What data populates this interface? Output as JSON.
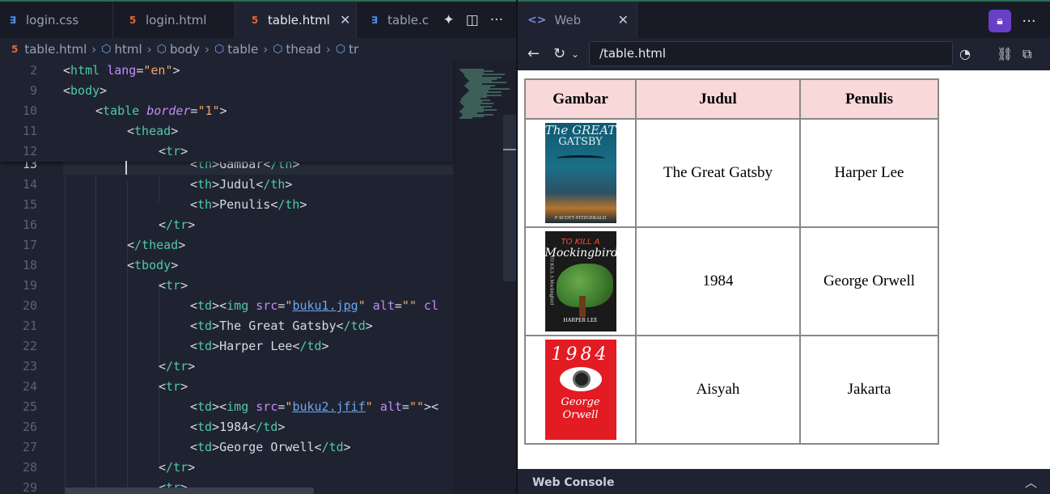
{
  "editor": {
    "tabs": [
      {
        "label": "login.css",
        "icon": "css-file-icon",
        "active": false
      },
      {
        "label": "login.html",
        "icon": "html-file-icon",
        "active": false
      },
      {
        "label": "table.html",
        "icon": "html-file-icon",
        "active": true
      },
      {
        "label": "table.c",
        "icon": "css-file-icon",
        "active": false
      }
    ],
    "breadcrumb": [
      "table.html",
      "html",
      "body",
      "table",
      "thead",
      "tr"
    ],
    "line_numbers": [
      "2",
      "9",
      "10",
      "11",
      "12",
      "13",
      "14",
      "15",
      "16",
      "17",
      "18",
      "19",
      "20",
      "21",
      "22",
      "23",
      "24",
      "25",
      "26",
      "27",
      "28",
      "29"
    ],
    "sticky_lines": [
      {
        "num": "2",
        "code": "<html lang=\"en\">"
      },
      {
        "num": "9",
        "code": "<body>"
      },
      {
        "num": "10",
        "code": "<table border=\"1\">"
      },
      {
        "num": "11",
        "code": "<thead>"
      },
      {
        "num": "12",
        "code": "<tr>"
      }
    ],
    "lines": [
      {
        "num": "13",
        "code": "<th>Gambar</th>"
      },
      {
        "num": "14",
        "code": "<th>Judul</th>"
      },
      {
        "num": "15",
        "code": "<th>Penulis</th>"
      },
      {
        "num": "16",
        "code": "</tr>"
      },
      {
        "num": "17",
        "code": "</thead>"
      },
      {
        "num": "18",
        "code": "<tbody>"
      },
      {
        "num": "19",
        "code": "<tr>"
      },
      {
        "num": "20",
        "code": "<td><img src=\"buku1.jpg\" alt=\"\" cl"
      },
      {
        "num": "21",
        "code": "<td>The Great Gatsby</td>"
      },
      {
        "num": "22",
        "code": "<td>Harper Lee</td>"
      },
      {
        "num": "23",
        "code": "</tr>"
      },
      {
        "num": "24",
        "code": "<tr>"
      },
      {
        "num": "25",
        "code": "<td><img src=\"buku2.jfif\" alt=\"\"><"
      },
      {
        "num": "26",
        "code": "<td>1984</td>"
      },
      {
        "num": "27",
        "code": "<td>George Orwell</td>"
      },
      {
        "num": "28",
        "code": "</tr>"
      },
      {
        "num": "29",
        "code": "<tr>"
      }
    ]
  },
  "browser": {
    "tab_label": "Web",
    "url": "/table.html",
    "table": {
      "headers": [
        "Gambar",
        "Judul",
        "Penulis"
      ],
      "rows": [
        {
          "cover": "The Great Gatsby",
          "judul": "The Great Gatsby",
          "penulis": "Harper Lee"
        },
        {
          "cover": "To Kill a Mockingbird",
          "judul": "1984",
          "penulis": "George Orwell"
        },
        {
          "cover": "1984 George Orwell",
          "judul": "Aisyah",
          "penulis": "Jakarta"
        }
      ]
    },
    "covers": {
      "gatsby_title_1": "The GREAT",
      "gatsby_title_2": "GATSBY",
      "gatsby_author": "F·SCOTT·FITZGERALD",
      "mock_title_1": "TO KILL A",
      "mock_title_2": "Mockingbird",
      "mock_author": "HARPER LEE",
      "mock_side": "TO KILL A Mockingbird",
      "orwell_title": "1984",
      "orwell_author": "George Orwell"
    },
    "console_label": "Web Console"
  },
  "colors": {
    "accent_purple": "#6a3fc8",
    "header_fill": "#f8d8d8",
    "tag_green": "#4fc9a4",
    "attr_purple": "#c58af9",
    "string_orange": "#f0a868"
  }
}
